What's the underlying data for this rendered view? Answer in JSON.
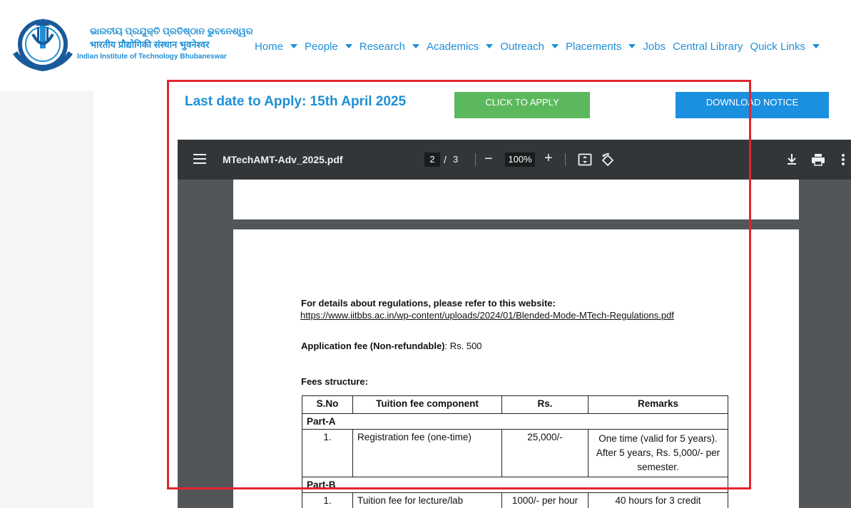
{
  "logo": {
    "line1": "ଭାରତୀୟ ପ୍ରଯୁକ୍ତି ପ୍ରତିଷ୍ଠାନ ଭୁବନେଶ୍ୱର",
    "line2": "भारतीय प्रौद्योगिकी संस्थान भुवनेश्वर",
    "line3": "Indian Institute of Technology Bhubaneswar"
  },
  "nav": {
    "items": [
      {
        "label": "Home",
        "dropdown": true
      },
      {
        "label": "People",
        "dropdown": true
      },
      {
        "label": "Research",
        "dropdown": true
      },
      {
        "label": "Academics",
        "dropdown": true
      },
      {
        "label": "Outreach",
        "dropdown": true
      },
      {
        "label": "Placements",
        "dropdown": true
      },
      {
        "label": "Jobs",
        "dropdown": false
      },
      {
        "label": "Central Library",
        "dropdown": false
      },
      {
        "label": "Quick Links",
        "dropdown": true
      }
    ]
  },
  "apply_bar": {
    "last_date": "Last date to Apply: 15th April 2025",
    "apply_label": "CLICK TO APPLY",
    "notice_label": "DOWNLOAD NOTICE"
  },
  "viewer": {
    "filename": "MTechAMT-Adv_2025.pdf",
    "current_page": "2",
    "slash": "/",
    "total_pages": "3",
    "zoom": "100%"
  },
  "document": {
    "regulations_heading": "For details about regulations, please refer to this website:",
    "regulations_url": "https://www.iitbbs.ac.in/wp-content/uploads/2024/01/Blended-Mode-MTech-Regulations.pdf",
    "fee_label": "Application fee (Non-refundable)",
    "fee_value": ": Rs. 500",
    "fees_structure": "Fees structure:",
    "table": {
      "headers": [
        "S.No",
        "Tuition fee component",
        "Rs.",
        "Remarks"
      ],
      "part_a": "Part-A",
      "row1": {
        "sno": "1.",
        "component": "Registration fee (one-time)",
        "rs": "25,000/-",
        "remarks": "One time (valid for 5 years). After 5 years, Rs. 5,000/- per semester."
      },
      "part_b": "Part-B",
      "row2": {
        "sno": "1.",
        "component": "Tuition fee for lecture/lab",
        "rs": "1000/- per hour",
        "remarks": "40 hours for 3 credit"
      }
    }
  },
  "colors": {
    "brand_blue": "#1d8fd6",
    "apply_green": "#5cb85c",
    "notice_blue": "#1b8fe0",
    "highlight_red": "#e1262d"
  }
}
